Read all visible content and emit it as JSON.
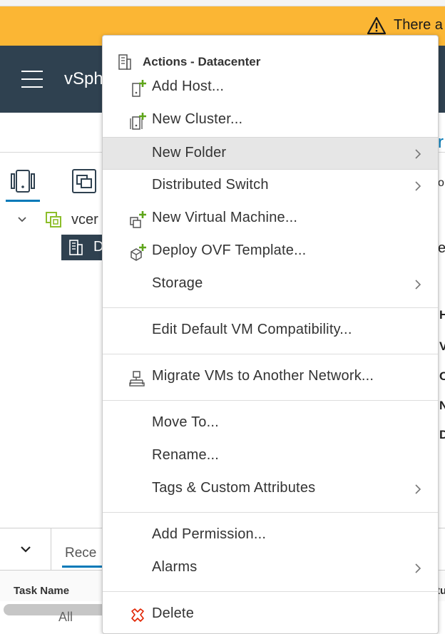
{
  "alert": {
    "text": "There a",
    "icon": "warning-icon"
  },
  "header": {
    "app_title": "vSph",
    "menu_icon": "hamburger-icon"
  },
  "tree": {
    "root_label": "vcer",
    "selected_label": "D",
    "root_icon": "vcenter-icon",
    "selected_icon": "datacenter-icon"
  },
  "right_fragments": [
    "r",
    "or",
    "e",
    "H",
    "V",
    "C",
    "N",
    "D"
  ],
  "bottom": {
    "recent_tab": "Rece",
    "task_name_header": "Task Name",
    "status_header_fragment": "tu",
    "filter_all": "All"
  },
  "menu": {
    "title": "Actions - Datacenter",
    "title_icon": "datacenter-icon",
    "items": [
      {
        "label": "Add Host...",
        "icon": "add-host-icon",
        "submenu": false
      },
      {
        "label": "New Cluster...",
        "icon": "new-cluster-icon",
        "submenu": false
      },
      {
        "label": "New Folder",
        "icon": "",
        "submenu": true,
        "highlighted": true
      },
      {
        "label": "Distributed Switch",
        "icon": "",
        "submenu": true
      },
      {
        "label": "New Virtual Machine...",
        "icon": "new-vm-icon",
        "submenu": false
      },
      {
        "label": "Deploy OVF Template...",
        "icon": "deploy-ovf-icon",
        "submenu": false
      },
      {
        "label": "Storage",
        "icon": "",
        "submenu": true
      },
      {
        "label": "Edit Default VM Compatibility...",
        "icon": "",
        "submenu": false
      },
      {
        "label": "Migrate VMs to Another Network...",
        "icon": "migrate-network-icon",
        "submenu": false
      },
      {
        "label": "Move To...",
        "icon": "",
        "submenu": false
      },
      {
        "label": "Rename...",
        "icon": "",
        "submenu": false
      },
      {
        "label": "Tags & Custom Attributes",
        "icon": "",
        "submenu": true
      },
      {
        "label": "Add Permission...",
        "icon": "",
        "submenu": false
      },
      {
        "label": "Alarms",
        "icon": "",
        "submenu": true
      },
      {
        "label": "Delete",
        "icon": "delete-icon",
        "submenu": false
      }
    ]
  },
  "colors": {
    "alert_bg": "#fbb634",
    "header_bg": "#2f4150",
    "accent_blue": "#0079b8",
    "add_green": "#5ea51a",
    "delete_red": "#e12200"
  }
}
